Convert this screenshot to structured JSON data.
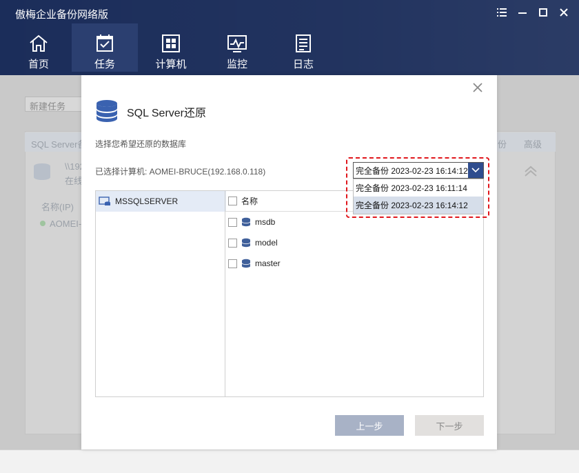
{
  "app": {
    "title": "傲梅企业备份网络版"
  },
  "nav": [
    {
      "label": "首页",
      "icon": "home-icon"
    },
    {
      "label": "任务",
      "icon": "task-icon"
    },
    {
      "label": "计算机",
      "icon": "windows-icon"
    },
    {
      "label": "监控",
      "icon": "monitor-icon"
    },
    {
      "label": "日志",
      "icon": "log-icon"
    }
  ],
  "background": {
    "new_task": "新建任务",
    "panel_title": "SQL Server备",
    "path": "\\\\192",
    "status": "在线",
    "col_name": "名称(IP)",
    "row_name": "AOMEI-B",
    "backup_col": "份",
    "advanced": "高级"
  },
  "dialog": {
    "title": "SQL Server还原",
    "subtitle": "选择您希望还原的数据库",
    "selected_computer": "已选择计算机: AOMEI-BRUCE(192.168.0.118)",
    "instance": "MSSQLSERVER",
    "column_name": "名称",
    "databases": [
      "msdb",
      "model",
      "master"
    ],
    "prev_label": "上一步",
    "next_label": "下一步"
  },
  "dropdown": {
    "value": "完全备份 2023-02-23 16:14:12",
    "options": [
      "完全备份 2023-02-23 16:11:14",
      "完全备份 2023-02-23 16:14:12"
    ]
  },
  "colors": {
    "nav_bg": "#1b2d5a",
    "accent": "#2f4d8e",
    "highlight": "#e0151b"
  }
}
